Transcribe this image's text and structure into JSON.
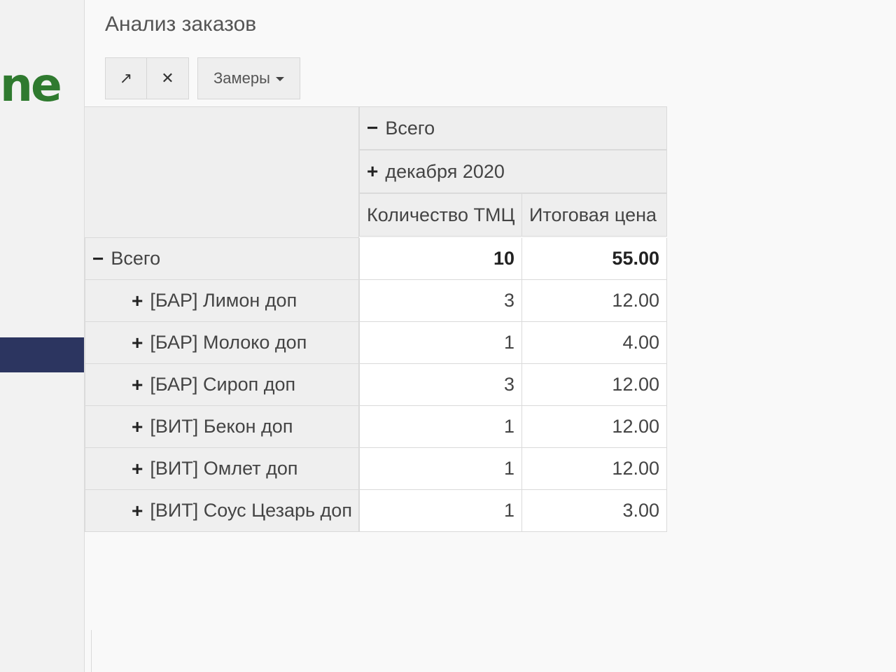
{
  "brand": {
    "text": "ne",
    "color": "#2f7a2f"
  },
  "page": {
    "title": "Анализ заказов"
  },
  "toolbar": {
    "expand_icon": "↗",
    "collapse_icon": "✕",
    "measures_label": "Замеры"
  },
  "pivot": {
    "col_total_label": "Всего",
    "col_total_symbol": "−",
    "col_group_label": "декабря 2020",
    "col_group_symbol": "+",
    "measure_headers": [
      "Количество ТМЦ",
      "Итоговая цена"
    ],
    "total_row": {
      "symbol": "−",
      "label": "Всего",
      "qty": "10",
      "price": "55.00"
    },
    "rows": [
      {
        "symbol": "+",
        "label": "[БАР] Лимон доп",
        "qty": "3",
        "price": "12.00"
      },
      {
        "symbol": "+",
        "label": "[БАР] Молоко доп",
        "qty": "1",
        "price": "4.00"
      },
      {
        "symbol": "+",
        "label": "[БАР] Сироп доп",
        "qty": "3",
        "price": "12.00"
      },
      {
        "symbol": "+",
        "label": "[ВИТ] Бекон доп",
        "qty": "1",
        "price": "12.00"
      },
      {
        "symbol": "+",
        "label": "[ВИТ] Омлет доп",
        "qty": "1",
        "price": "12.00"
      },
      {
        "symbol": "+",
        "label": "[ВИТ] Соус Цезарь доп",
        "qty": "1",
        "price": "3.00"
      }
    ]
  },
  "colors": {
    "sidebar_active": "#2c3560"
  }
}
